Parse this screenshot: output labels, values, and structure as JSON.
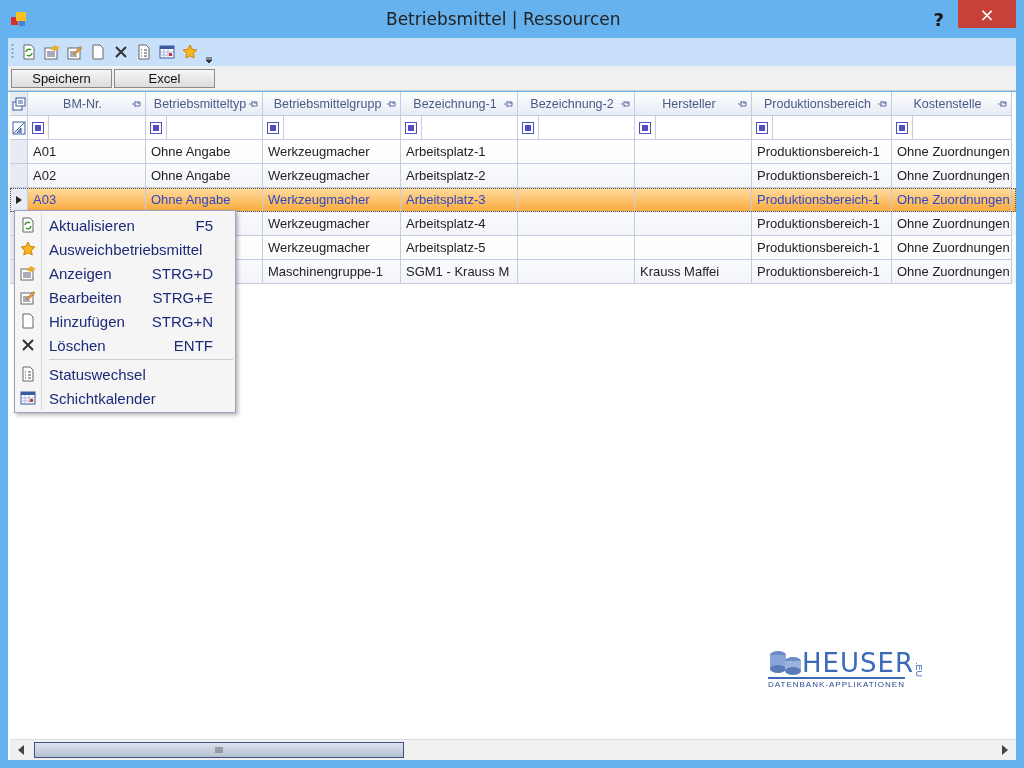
{
  "window": {
    "title": "Betriebsmittel | Ressourcen",
    "help": "?",
    "close": "×"
  },
  "buttons": [
    "Speichern",
    "Excel"
  ],
  "table": {
    "columns": [
      "BM-Nr.",
      "Betriebsmitteltyp",
      "Betriebsmittelgrupp",
      "Bezeichnung-1",
      "Bezeichnung-2",
      "Hersteller",
      "Produktionsbereich",
      "Kostenstelle"
    ],
    "rows": [
      {
        "selected": false,
        "cells": [
          "A01",
          "Ohne Angabe",
          "Werkzeugmacher",
          "Arbeitsplatz-1",
          "",
          "",
          "Produktionsbereich-1",
          "Ohne Zuordnungen"
        ]
      },
      {
        "selected": false,
        "cells": [
          "A02",
          "Ohne Angabe",
          "Werkzeugmacher",
          "Arbeitsplatz-2",
          "",
          "",
          "Produktionsbereich-1",
          "Ohne Zuordnungen"
        ]
      },
      {
        "selected": true,
        "cells": [
          "A03",
          "Ohne Angabe",
          "Werkzeugmacher",
          "Arbeitsplatz-3",
          "",
          "",
          "Produktionsbereich-1",
          "Ohne Zuordnungen"
        ]
      },
      {
        "selected": false,
        "cells": [
          "",
          "",
          "Werkzeugmacher",
          "Arbeitsplatz-4",
          "",
          "",
          "Produktionsbereich-1",
          "Ohne Zuordnungen"
        ]
      },
      {
        "selected": false,
        "cells": [
          "",
          "",
          "Werkzeugmacher",
          "Arbeitsplatz-5",
          "",
          "",
          "Produktionsbereich-1",
          "Ohne Zuordnungen"
        ]
      },
      {
        "selected": false,
        "cells": [
          "",
          "",
          "Maschinengruppe-1",
          "SGM1 - Krauss M",
          "",
          "Krauss Maffei",
          "Produktionsbereich-1",
          "Ohne Zuordnungen"
        ]
      }
    ]
  },
  "context_menu": [
    {
      "kind": "refresh",
      "label": "Aktualisieren",
      "shortcut": "F5"
    },
    {
      "kind": "star",
      "label": "Ausweichbetriebsmittel"
    },
    {
      "kind": "view",
      "label": "Anzeigen",
      "shortcut": "STRG+D"
    },
    {
      "kind": "edit",
      "label": "Bearbeiten",
      "shortcut": "STRG+E"
    },
    {
      "kind": "new",
      "label": "Hinzufügen",
      "shortcut": "STRG+N"
    },
    {
      "kind": "delete",
      "label": "Löschen",
      "shortcut": "ENTF"
    },
    {
      "kind": "separator"
    },
    {
      "kind": "status",
      "label": "Statuswechsel"
    },
    {
      "kind": "calendar",
      "label": "Schichtkalender"
    }
  ],
  "logo": {
    "name": "HEUSER",
    "suffix": ".EU",
    "tagline": "DATENBANK-APPLIKATIONEN"
  }
}
